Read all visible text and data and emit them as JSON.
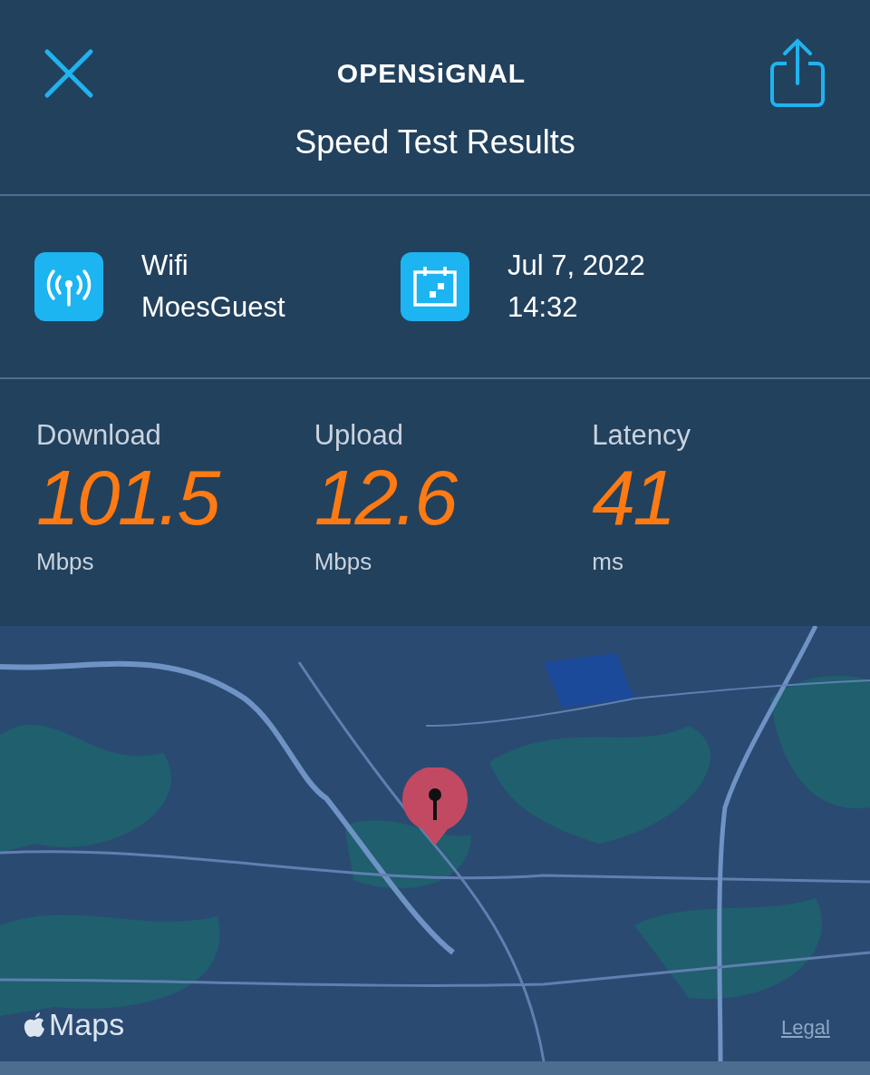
{
  "header": {
    "logo": "OPENSiGNAL",
    "title": "Speed Test Results"
  },
  "info": [
    {
      "kind": "network",
      "line1": "Wifi",
      "line2": "MoesGuest"
    },
    {
      "kind": "date",
      "line1": "Jul 7, 2022",
      "line2": "14:32"
    }
  ],
  "metrics": [
    {
      "label": "Download",
      "value": "101.5",
      "unit": "Mbps"
    },
    {
      "label": "Upload",
      "value": "12.6",
      "unit": "Mbps"
    },
    {
      "label": "Latency",
      "value": "41",
      "unit": "ms"
    }
  ],
  "map": {
    "kind": "picture",
    "attribution": "Maps",
    "legal": "Legal"
  }
}
